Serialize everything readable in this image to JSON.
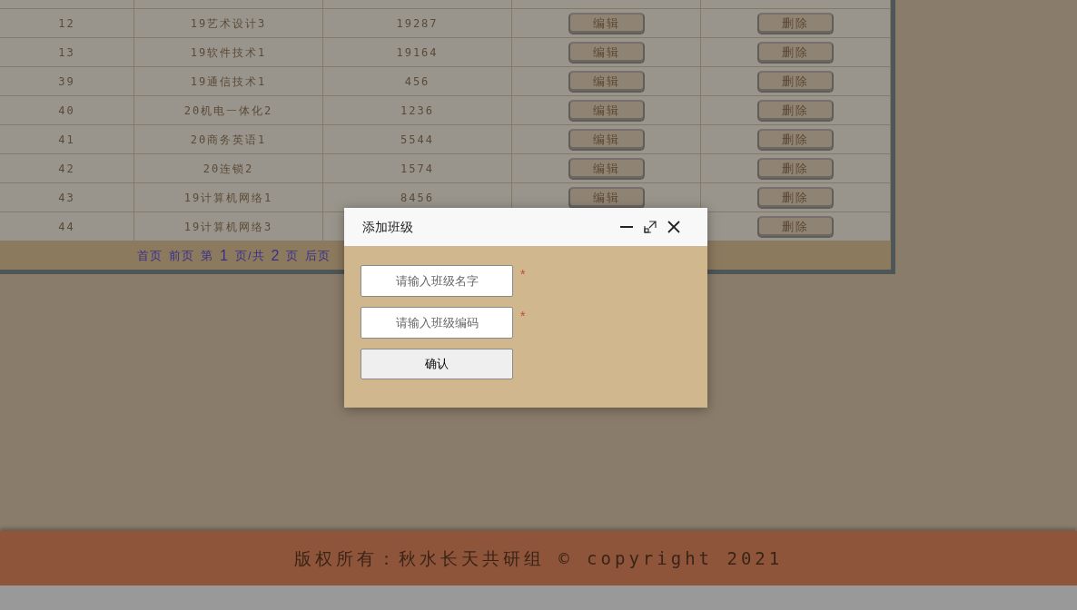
{
  "table": {
    "rows": [
      {
        "id": "12",
        "name": "19艺术设计3",
        "code": "19287",
        "edit": "编辑",
        "delete": "删除"
      },
      {
        "id": "13",
        "name": "19软件技术1",
        "code": "19164",
        "edit": "编辑",
        "delete": "删除"
      },
      {
        "id": "39",
        "name": "19通信技术1",
        "code": "456",
        "edit": "编辑",
        "delete": "删除"
      },
      {
        "id": "40",
        "name": "20机电一体化2",
        "code": "1236",
        "edit": "编辑",
        "delete": "删除"
      },
      {
        "id": "41",
        "name": "20商务英语1",
        "code": "5544",
        "edit": "编辑",
        "delete": "删除"
      },
      {
        "id": "42",
        "name": "20连锁2",
        "code": "1574",
        "edit": "编辑",
        "delete": "删除"
      },
      {
        "id": "43",
        "name": "19计算机网络1",
        "code": "8456",
        "edit": "编辑",
        "delete": "删除"
      },
      {
        "id": "44",
        "name": "19计算机网络3",
        "delete": "删除"
      }
    ]
  },
  "pager": [
    {
      "kind": "link",
      "text": "首页"
    },
    {
      "kind": "link",
      "text": "前页"
    },
    {
      "kind": "text",
      "text": "第"
    },
    {
      "kind": "number",
      "text": "1"
    },
    {
      "kind": "text",
      "text": "页/共"
    },
    {
      "kind": "number",
      "text": "2"
    },
    {
      "kind": "text",
      "text": "页"
    },
    {
      "kind": "link",
      "text": "后页"
    }
  ],
  "dialog": {
    "title": "添加班级",
    "fields": [
      {
        "placeholder": "请输入班级名字",
        "required": "*"
      },
      {
        "placeholder": "请输入班级编码",
        "required": "*"
      }
    ],
    "submit": "确认"
  },
  "footer": "版权所有：秋水长天共研组 © copyright 2021"
}
